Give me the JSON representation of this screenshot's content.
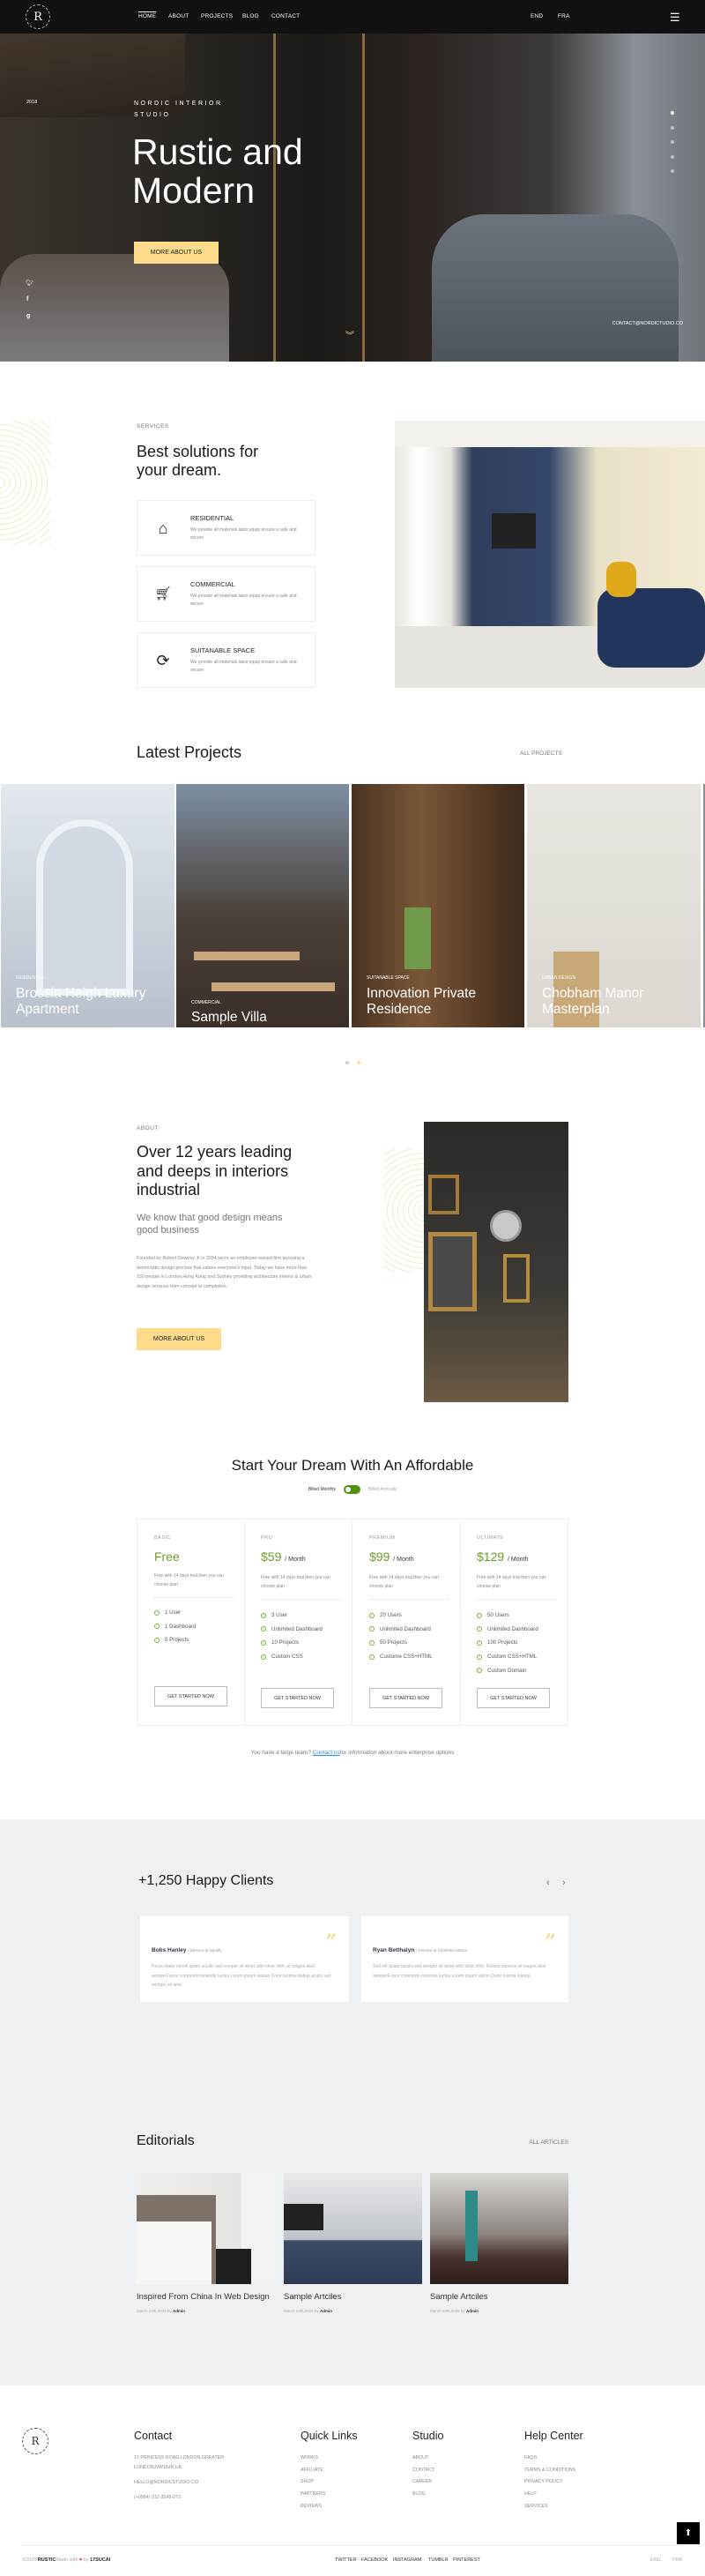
{
  "nav": {
    "logo": "R",
    "links": [
      "HOME",
      "ABOUT",
      "PROJECTS",
      "BLOG",
      "CONTACT"
    ],
    "lang": [
      "END",
      "FRA"
    ],
    "menu_icon": "hamburger-icon"
  },
  "hero": {
    "year": "2018",
    "kicker_1": "NORDIC INTERIOR",
    "kicker_2": "STUDIO",
    "title_1": "Rustic and",
    "title_2": "Modern",
    "button": "MORE ABOUT US",
    "social": [
      "twitter",
      "facebook",
      "google"
    ],
    "email": "CONTACT@NORDICTUDIO.CO",
    "slides": 5,
    "active_slide": 1
  },
  "services": {
    "kicker": "SERVICES",
    "title_1": "Best solutions for",
    "title_2": "your dream.",
    "items": [
      {
        "title": "RESIDENTIAL",
        "desc": "We provide all materials,labor,equip ensure a safe and secure",
        "icon": "house-icon"
      },
      {
        "title": "COMMERCIAL",
        "desc": "We provide all materials,labor,equip ensure a safe and secure",
        "icon": "cart-icon"
      },
      {
        "title": "SUITANABLE SPACE",
        "desc": "We provide all materials,labor,equip ensure a safe and secure",
        "icon": "refresh-icon"
      }
    ]
  },
  "projects": {
    "title": "Latest Projects",
    "all": "ALL PROJECTS",
    "items": [
      {
        "category": "RESIDENTIAL",
        "title": "Brossia Heigh Luxury Apartment"
      },
      {
        "category": "COMMERCIAL",
        "title": "Sample Villa"
      },
      {
        "category": "SUITANABLE SPACE",
        "title": "Innovation Private Residence"
      },
      {
        "category": "URBAN DESIGN",
        "title": "Chobham Manor Masterplan"
      }
    ],
    "pages": 2,
    "active_page": 2
  },
  "about": {
    "kicker": "ABOUT",
    "title": "Over 12 years leading and deeps in interiors industrial",
    "subtitle": "We know that good design means good business",
    "body": "Founded by Robert Downey Jr in 2004,we're an employee-owned firm pursuing a democratic design process that values everyone's input. Today we have more than 150 people in London,Hong Kong and Sydney providing architecture,interior & urban design services from concept to completion.",
    "button": "MORE ABOUT US"
  },
  "pricing": {
    "title": "Start Your Dream With An Affordable",
    "billed_monthly": "Billed Monthly",
    "billed_annually": "Billed Annually",
    "toggle_on": true,
    "plans": [
      {
        "label": "BASIC",
        "price": "Free",
        "per": "",
        "desc": "Free with 14 days trial,then you can choose plan",
        "features": [
          "1 User",
          "1 Dashboard",
          "5 Projects"
        ],
        "button": "GET STARTED NOW"
      },
      {
        "label": "PRO",
        "price": "$59",
        "per": "/ Month",
        "desc": "Free with 14 days trial,then you can choose plan",
        "features": [
          "3 User",
          "Unlimited Dashboard",
          "10 Projects",
          "Custom CSS"
        ],
        "button": "GET STARTED NOW"
      },
      {
        "label": "PREMIUM",
        "price": "$99",
        "per": "/ Month",
        "desc": "Free with 14 days trial,then you can choose plan",
        "features": [
          "20 Users",
          "Unlimited Dashboard",
          "50 Projects",
          "Custome CSS+HTML"
        ],
        "button": "GET STARTED NOW"
      },
      {
        "label": "ULTIMATE",
        "price": "$129",
        "per": "/ Month",
        "desc": "Free with 14 days trial,then you can choose plan",
        "features": [
          "50 Users",
          "Unlimited Dashboard",
          "100 Projects",
          "Custom CSS+HTML",
          "Custom Domain"
        ],
        "button": "GET STARTED NOW"
      }
    ],
    "note_pre": "You have a large team? ",
    "note_link": "Contact us",
    "note_post": "for information about more enterprise options"
  },
  "clients": {
    "title": "+1,250 Happy Clients",
    "items": [
      {
        "name": "Bobs Hanley",
        "role": "/ Director at Spotify",
        "text": "Paras stalor ed elit quam,iaculis sed semper sit amet udin vitae nibh. at magna akal semperFusce commodo molestie luctus.Lorem ipsum vitalun Dolor tusima olatiup aculis sed semper sit ame"
      },
      {
        "name": "Ryan Betthalyn",
        "role": "/ Director at Chobham Manor",
        "text": "Sed elit quam,iaculis sed semper sit amet udin vitae nibh. Rubino staveuo at magna akal semperFusce commodo molestie luctus.Lorem ipsum ulicon Dolor tusima olatiup."
      }
    ]
  },
  "editorials": {
    "title": "Editorials",
    "all": "ALL ARTICLES",
    "items": [
      {
        "title": "Inspired From China In Web Design",
        "date": "March 24th,2025 by ",
        "author": "Admin"
      },
      {
        "title": "Sample Artciles",
        "date": "March 24th,2025 by ",
        "author": "Admin"
      },
      {
        "title": "Sample Artciles",
        "date": "March 24th,2025 by ",
        "author": "Admin"
      }
    ]
  },
  "footer": {
    "logo": "R",
    "contact": {
      "title": "Contact",
      "address_1": "17 PRINCESS ROAD,LONDON,GREATER",
      "address_2": "LONDON,NW18JR,UK",
      "email": "HELLO@NORDICSTUDIO.CO",
      "phone": "(+0084) 912-3548-073"
    },
    "quick": {
      "title": "Quick Links",
      "items": [
        "WORKS",
        "AFFILIATE",
        "SHOP",
        "PARTNERS",
        "REVIEWS"
      ]
    },
    "studio": {
      "title": "Studio",
      "items": [
        "ABOUT",
        "CONTACT",
        "CAREER",
        "BLOG"
      ]
    },
    "help": {
      "title": "Help Center",
      "items": [
        "FAQS",
        "TERMS & CONDITIONS",
        "PRIVACY POLICY",
        "HELP",
        "SERVICES"
      ]
    },
    "copy_pre": "©2025 ",
    "brand": "RUSTIC",
    "copy_mid": "Made with ",
    "copy_by": " by ",
    "author": "17SUCAI",
    "social": [
      "TWITTER",
      "FACEBOOK",
      "INSTAGRAM",
      "TUMBLR",
      "PINTEREST"
    ],
    "lang": [
      "ENG",
      "FRA"
    ]
  },
  "colors": {
    "accent": "#fedb8b",
    "price_green": "#6a9b2a",
    "dark": "#111111",
    "gray_bg": "#eef1f3"
  }
}
